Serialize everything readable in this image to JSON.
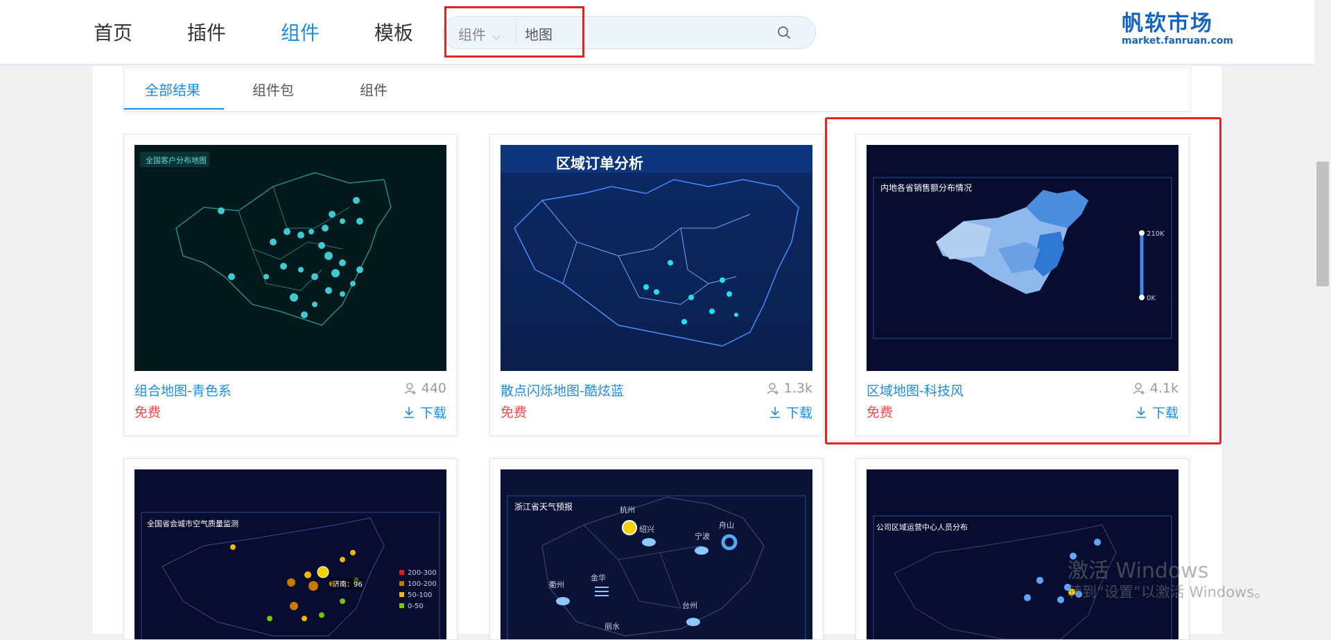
{
  "nav": {
    "items": [
      {
        "label": "首页"
      },
      {
        "label": "插件"
      },
      {
        "label": "组件"
      },
      {
        "label": "模板"
      }
    ],
    "active": "组件"
  },
  "search": {
    "category": "组件",
    "value": "地图"
  },
  "logo": {
    "cn": "帆软市场",
    "en": "market.fanruan.com"
  },
  "tabs": [
    {
      "label": "全部结果"
    },
    {
      "label": "组件包"
    },
    {
      "label": "组件"
    }
  ],
  "cards": [
    {
      "title": "组合地图-青色系",
      "price": "免费",
      "count": "440",
      "download": "下载",
      "thumb_caption": "全国客户分布地图"
    },
    {
      "title": "散点闪烁地图-酷炫蓝",
      "price": "免费",
      "count": "1.3k",
      "download": "下载",
      "thumb_caption": "区域订单分析"
    },
    {
      "title": "区域地图-科技风",
      "price": "免费",
      "count": "4.1k",
      "download": "下载",
      "thumb_caption": "内地各省销售额分布情况",
      "legend_max": "210K",
      "legend_min": "0K"
    },
    {
      "thumb_caption": "全国省会城市空气质量监测",
      "legend": [
        "200-300",
        "100-200",
        "50-100",
        "0-50"
      ],
      "tooltip": "济南：96"
    },
    {
      "thumb_caption": "浙江省天气预报",
      "labels": [
        "杭州",
        "绍兴",
        "宁波",
        "舟山",
        "衢州",
        "金华",
        "台州",
        "丽水"
      ]
    },
    {
      "thumb_caption": "公司区域运营中心人员分布"
    }
  ],
  "watermark": {
    "line1": "激活 Windows",
    "line2": "转到“设置”以激活 Windows。"
  },
  "colors": {
    "accent": "#1d8ce0",
    "price": "#f04848",
    "highlight": "#e3231f"
  }
}
